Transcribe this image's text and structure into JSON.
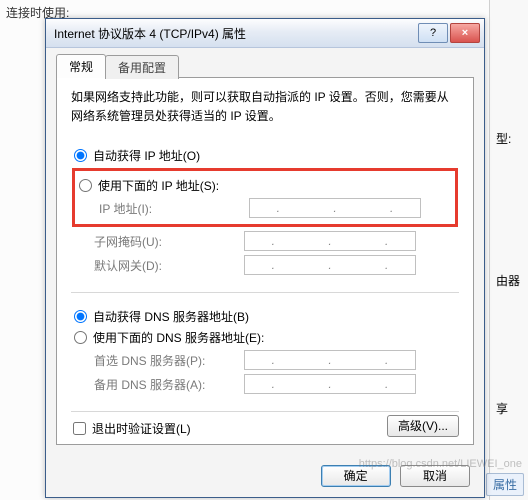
{
  "background": {
    "top_text": "连接时使用:",
    "right_labels": [
      "型:",
      "由器",
      "享"
    ],
    "bottom_button": "属性"
  },
  "dialog": {
    "title": "Internet 协议版本 4 (TCP/IPv4) 属性",
    "help_btn": "?",
    "close_btn": "×",
    "tabs": {
      "general": "常规",
      "alt": "备用配置"
    },
    "description": "如果网络支持此功能，则可以获取自动指派的 IP 设置。否则，您需要从网络系统管理员处获得适当的 IP 设置。",
    "ip_section": {
      "auto": "自动获得 IP 地址(O)",
      "manual": "使用下面的 IP 地址(S):",
      "fields": {
        "ip": "IP 地址(I):",
        "subnet": "子网掩码(U):",
        "gateway": "默认网关(D):"
      }
    },
    "dns_section": {
      "auto": "自动获得 DNS 服务器地址(B)",
      "manual": "使用下面的 DNS 服务器地址(E):",
      "fields": {
        "primary": "首选 DNS 服务器(P):",
        "alternate": "备用 DNS 服务器(A):"
      }
    },
    "validate_checkbox": "退出时验证设置(L)",
    "advanced_btn": "高级(V)...",
    "ok_btn": "确定",
    "cancel_btn": "取消"
  },
  "watermark": "https://blog.csdn.net/LIEWEI_one"
}
